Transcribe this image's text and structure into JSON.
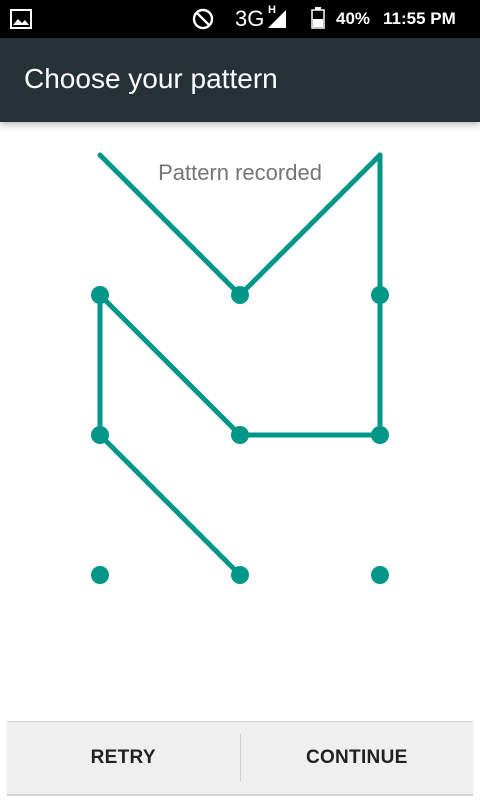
{
  "status_bar": {
    "icons": [
      "gallery-icon",
      "do-not-disturb-icon",
      "signal-icon",
      "battery-icon"
    ],
    "network": "3G",
    "network_sup": "H",
    "battery": "40%",
    "time": "11:55 PM"
  },
  "app_bar": {
    "title": "Choose your pattern",
    "background": "#263238"
  },
  "pattern": {
    "status": "Pattern recorded",
    "color": "#009688",
    "grid_size": 3,
    "sequence": [
      [
        1,
        3
      ],
      [
        0,
        2
      ],
      [
        0,
        1
      ],
      [
        1,
        2
      ],
      [
        2,
        2
      ],
      [
        2,
        1
      ],
      [
        2,
        0
      ],
      [
        1,
        1
      ],
      [
        0,
        0
      ]
    ]
  },
  "footer": {
    "retry_label": "RETRY",
    "continue_label": "CONTINUE"
  }
}
